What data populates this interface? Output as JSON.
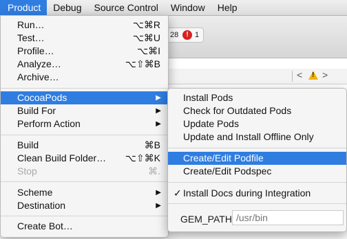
{
  "menubar": {
    "items": [
      "Product",
      "Debug",
      "Source Control",
      "Window",
      "Help"
    ],
    "active_color": "#2f7de1"
  },
  "background": {
    "status_count": "28",
    "error_count": "1",
    "error_icon_text": "!",
    "nav_back": "<",
    "nav_forward": ">",
    "warning_icon_text": "!"
  },
  "product_menu": {
    "items": [
      {
        "label": "Run…",
        "shortcut": "⌥⌘R"
      },
      {
        "label": "Test…",
        "shortcut": "⌥⌘U"
      },
      {
        "label": "Profile…",
        "shortcut": "⌥⌘I"
      },
      {
        "label": "Analyze…",
        "shortcut": "⌥⇧⌘B"
      },
      {
        "label": "Archive…",
        "shortcut": ""
      },
      {
        "label": "CocoaPods",
        "submenu": true,
        "highlighted": true
      },
      {
        "label": "Build For",
        "submenu": true
      },
      {
        "label": "Perform Action",
        "submenu": true
      },
      {
        "label": "Build",
        "shortcut": "⌘B"
      },
      {
        "label": "Clean Build Folder…",
        "shortcut": "⌥⇧⌘K"
      },
      {
        "label": "Stop",
        "shortcut": "⌘.",
        "disabled": true
      },
      {
        "label": "Scheme",
        "submenu": true
      },
      {
        "label": "Destination",
        "submenu": true
      },
      {
        "label": "Create Bot…",
        "shortcut": ""
      }
    ],
    "submenu_arrow": "▶"
  },
  "cocoapods_menu": {
    "items": [
      {
        "label": "Install Pods"
      },
      {
        "label": "Check for Outdated Pods"
      },
      {
        "label": "Update Pods"
      },
      {
        "label": "Update and Install Offline Only"
      },
      {
        "label": "Create/Edit Podfile",
        "highlighted": true
      },
      {
        "label": "Create/Edit Podspec"
      },
      {
        "label": "Install Docs during Integration",
        "checked": true
      }
    ],
    "check_mark": "✓",
    "gem_path_label": "GEM_PATH:",
    "gem_path_placeholder": "/usr/bin"
  }
}
